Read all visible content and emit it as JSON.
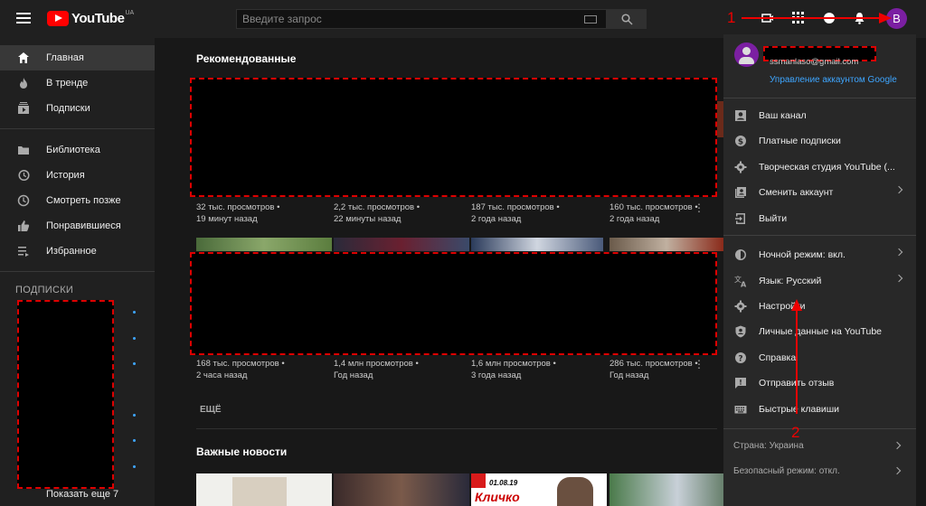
{
  "header": {
    "logo_text": "YouTube",
    "logo_region": "UA",
    "search_placeholder": "Введите запрос",
    "annotation_1": "1",
    "avatar_letter": "B"
  },
  "sidebar": {
    "items": [
      {
        "label": "Главная"
      },
      {
        "label": "В тренде"
      },
      {
        "label": "Подписки"
      },
      {
        "label": "Библиотека"
      },
      {
        "label": "История"
      },
      {
        "label": "Смотреть позже"
      },
      {
        "label": "Понравившиеся"
      },
      {
        "label": "Избранное"
      }
    ],
    "subscriptions_title": "ПОДПИСКИ",
    "show_more": "Показать еще 7"
  },
  "main": {
    "recommended_title": "Рекомендованные",
    "row1": [
      {
        "views": "32 тыс. просмотров •",
        "age": "19 минут назад"
      },
      {
        "views": "2,2 тыс. просмотров •",
        "age": "22 минуты назад"
      },
      {
        "views": "187 тыс. просмотров •",
        "age": "2 года назад"
      },
      {
        "views": "160 тыс. просмотров •",
        "age": "2 года назад"
      }
    ],
    "row2": [
      {
        "views": "168 тыс. просмотров •",
        "age": "2 часа назад"
      },
      {
        "views": "1,4 млн просмотров •",
        "age": "Год назад"
      },
      {
        "views": "1,6 млн просмотров •",
        "age": "3 года назад"
      },
      {
        "views": "286 тыс. просмотров •",
        "age": "Год назад"
      }
    ],
    "more_label": "ЕЩЁ",
    "news_title": "Важные новости",
    "news_thumb_date": "01.08.19",
    "news_thumb_text": "Кличко"
  },
  "account_menu": {
    "email": "ssmanlaso@gmail.com",
    "manage_account": "Управление аккаунтом Google",
    "items": [
      {
        "label": "Ваш канал"
      },
      {
        "label": "Платные подписки"
      },
      {
        "label": "Творческая студия YouTube (..."
      },
      {
        "label": "Сменить аккаунт"
      },
      {
        "label": "Выйти"
      },
      {
        "label": "Ночной режим: вкл."
      },
      {
        "label": "Язык: Русский"
      },
      {
        "label": "Настройки"
      },
      {
        "label": "Личные данные на YouTube"
      },
      {
        "label": "Справка"
      },
      {
        "label": "Отправить отзыв"
      },
      {
        "label": "Быстрые клавиши"
      }
    ],
    "country": "Страна: Украина",
    "safe_mode": "Безопасный режим: откл.",
    "annotation_2": "2"
  },
  "colors": {
    "brand": "#ff0000",
    "avatar": "#7b1fa2",
    "link": "#3ea6ff",
    "annotation": "#e00000"
  }
}
